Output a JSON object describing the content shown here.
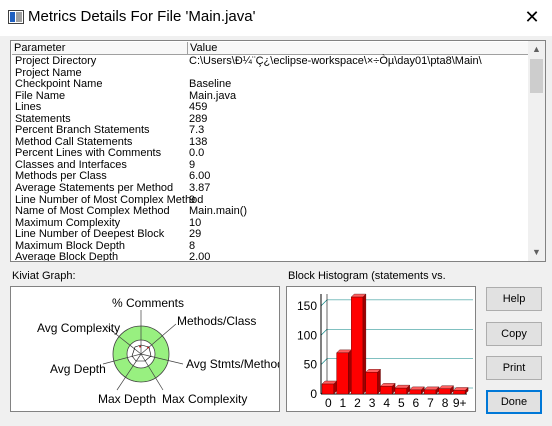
{
  "window": {
    "title": "Metrics Details For File 'Main.java'",
    "close_symbol": "✕"
  },
  "table": {
    "headers": [
      "Parameter",
      "Value"
    ],
    "rows": [
      [
        "Project Directory",
        "C:\\Users\\Ð¼¨Ç¿\\eclipse-workspace\\×÷Òµ\\day01\\pta8\\Main\\"
      ],
      [
        "Project Name",
        ""
      ],
      [
        "Checkpoint Name",
        "Baseline"
      ],
      [
        "File Name",
        "Main.java"
      ],
      [
        "Lines",
        "459"
      ],
      [
        "Statements",
        "289"
      ],
      [
        "Percent Branch Statements",
        "7.3"
      ],
      [
        "Method Call Statements",
        "138"
      ],
      [
        "Percent Lines with Comments",
        "0.0"
      ],
      [
        "Classes and Interfaces",
        "9"
      ],
      [
        "Methods per Class",
        "6.00"
      ],
      [
        "Average Statements per Method",
        "3.87"
      ],
      [
        "Line Number of Most Complex Method",
        "9"
      ],
      [
        "Name of Most Complex Method",
        "Main.main()"
      ],
      [
        "Maximum Complexity",
        "10"
      ],
      [
        "Line Number of Deepest Block",
        "29"
      ],
      [
        "Maximum Block Depth",
        "8"
      ],
      [
        "Average Block Depth",
        "2.00"
      ]
    ]
  },
  "kiviat": {
    "label": "Kiviat Graph:",
    "axes": [
      "% Comments",
      "Methods/Class",
      "Avg Stmts/Method",
      "Max Complexity",
      "Max Depth",
      "Avg Depth",
      "Avg Complexity"
    ]
  },
  "histogram": {
    "label": "Block Histogram (statements vs.",
    "y_ticks": [
      "150",
      "100",
      "50",
      "0"
    ],
    "x_ticks": [
      "0",
      "1",
      "2",
      "3",
      "4",
      "5",
      "6",
      "7",
      "8",
      "9+"
    ]
  },
  "buttons": {
    "help": "Help",
    "copy": "Copy",
    "print": "Print",
    "done": "Done"
  },
  "chart_data": {
    "type": "bar",
    "title": "Block Histogram (statements vs.",
    "categories": [
      "0",
      "1",
      "2",
      "3",
      "4",
      "5",
      "6",
      "7",
      "8",
      "9+"
    ],
    "values": [
      17,
      70,
      165,
      37,
      13,
      10,
      7,
      7,
      9,
      6
    ],
    "ylim": [
      0,
      160
    ],
    "grid": true,
    "colors": {
      "bar": "#ff0000",
      "grid": "#008080"
    }
  }
}
